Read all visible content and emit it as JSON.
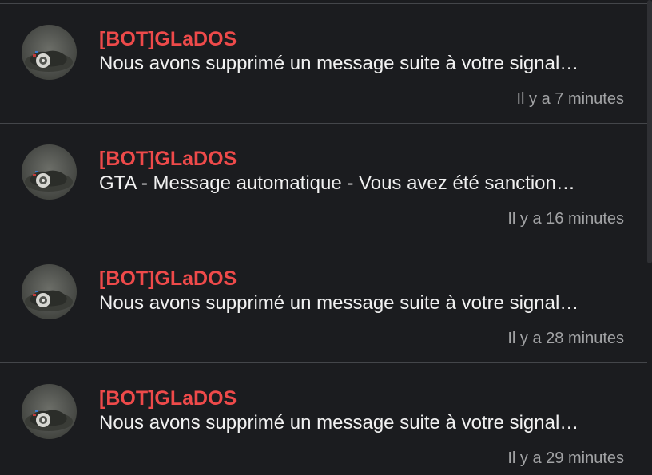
{
  "notifications": [
    {
      "author": "[BOT]GLaDOS",
      "message": "Nous avons supprimé un message suite à votre signal…",
      "time": "Il y a 7 minutes",
      "avatar_icon": "glados-avatar-icon"
    },
    {
      "author": "[BOT]GLaDOS",
      "message": "GTA - Message automatique - Vous avez été sanction…",
      "time": "Il y a 16 minutes",
      "avatar_icon": "glados-avatar-icon"
    },
    {
      "author": "[BOT]GLaDOS",
      "message": "Nous avons supprimé un message suite à votre signal…",
      "time": "Il y a 28 minutes",
      "avatar_icon": "glados-avatar-icon"
    },
    {
      "author": "[BOT]GLaDOS",
      "message": "Nous avons supprimé un message suite à votre signal…",
      "time": "Il y a 29 minutes",
      "avatar_icon": "glados-avatar-icon"
    }
  ],
  "colors": {
    "background": "#1b1c1f",
    "author": "#ee4a4a",
    "message": "#f1f1f1",
    "time": "#a2a3a5",
    "divider": "#44464a"
  }
}
